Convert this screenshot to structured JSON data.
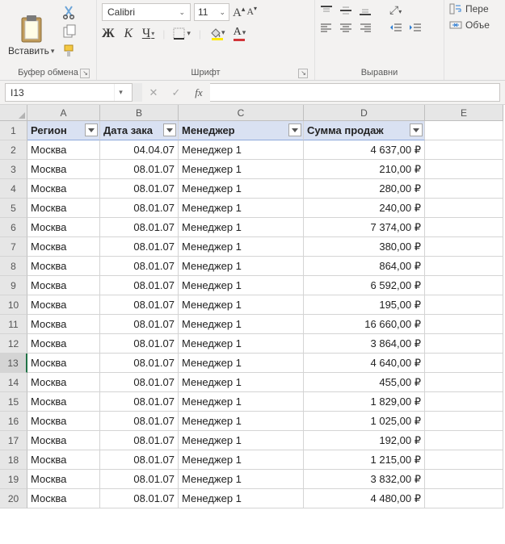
{
  "ribbon": {
    "clipboard": {
      "paste_label": "Вставить",
      "title": "Буфер обмена"
    },
    "font": {
      "name": "Calibri",
      "size": "11",
      "bold": "Ж",
      "italic": "К",
      "underline": "Ч",
      "title": "Шрифт"
    },
    "alignment": {
      "title": "Выравни"
    },
    "wrap_label": "Пере",
    "merge_label": "Объе"
  },
  "formula_bar": {
    "name_box": "I13",
    "cancel": "✕",
    "enter": "✓",
    "fx": "fx"
  },
  "grid": {
    "col_letters": [
      "A",
      "B",
      "C",
      "D",
      "E"
    ],
    "headers": [
      "Регион",
      "Дата зака",
      "Менеджер",
      "Сумма продаж"
    ],
    "rows": [
      {
        "n": "2",
        "a": "Москва",
        "b": "04.04.07",
        "c": "Менеджер 1",
        "d": "4 637,00 ₽"
      },
      {
        "n": "3",
        "a": "Москва",
        "b": "08.01.07",
        "c": "Менеджер 1",
        "d": "210,00 ₽"
      },
      {
        "n": "4",
        "a": "Москва",
        "b": "08.01.07",
        "c": "Менеджер 1",
        "d": "280,00 ₽"
      },
      {
        "n": "5",
        "a": "Москва",
        "b": "08.01.07",
        "c": "Менеджер 1",
        "d": "240,00 ₽"
      },
      {
        "n": "6",
        "a": "Москва",
        "b": "08.01.07",
        "c": "Менеджер 1",
        "d": "7 374,00 ₽"
      },
      {
        "n": "7",
        "a": "Москва",
        "b": "08.01.07",
        "c": "Менеджер 1",
        "d": "380,00 ₽"
      },
      {
        "n": "8",
        "a": "Москва",
        "b": "08.01.07",
        "c": "Менеджер 1",
        "d": "864,00 ₽"
      },
      {
        "n": "9",
        "a": "Москва",
        "b": "08.01.07",
        "c": "Менеджер 1",
        "d": "6 592,00 ₽"
      },
      {
        "n": "10",
        "a": "Москва",
        "b": "08.01.07",
        "c": "Менеджер 1",
        "d": "195,00 ₽"
      },
      {
        "n": "11",
        "a": "Москва",
        "b": "08.01.07",
        "c": "Менеджер 1",
        "d": "16 660,00 ₽"
      },
      {
        "n": "12",
        "a": "Москва",
        "b": "08.01.07",
        "c": "Менеджер 1",
        "d": "3 864,00 ₽"
      },
      {
        "n": "13",
        "a": "Москва",
        "b": "08.01.07",
        "c": "Менеджер 1",
        "d": "4 640,00 ₽",
        "sel": true
      },
      {
        "n": "14",
        "a": "Москва",
        "b": "08.01.07",
        "c": "Менеджер 1",
        "d": "455,00 ₽"
      },
      {
        "n": "15",
        "a": "Москва",
        "b": "08.01.07",
        "c": "Менеджер 1",
        "d": "1 829,00 ₽"
      },
      {
        "n": "16",
        "a": "Москва",
        "b": "08.01.07",
        "c": "Менеджер 1",
        "d": "1 025,00 ₽"
      },
      {
        "n": "17",
        "a": "Москва",
        "b": "08.01.07",
        "c": "Менеджер 1",
        "d": "192,00 ₽"
      },
      {
        "n": "18",
        "a": "Москва",
        "b": "08.01.07",
        "c": "Менеджер 1",
        "d": "1 215,00 ₽"
      },
      {
        "n": "19",
        "a": "Москва",
        "b": "08.01.07",
        "c": "Менеджер 1",
        "d": "3 832,00 ₽"
      },
      {
        "n": "20",
        "a": "Москва",
        "b": "08.01.07",
        "c": "Менеджер 1",
        "d": "4 480,00 ₽"
      }
    ]
  }
}
